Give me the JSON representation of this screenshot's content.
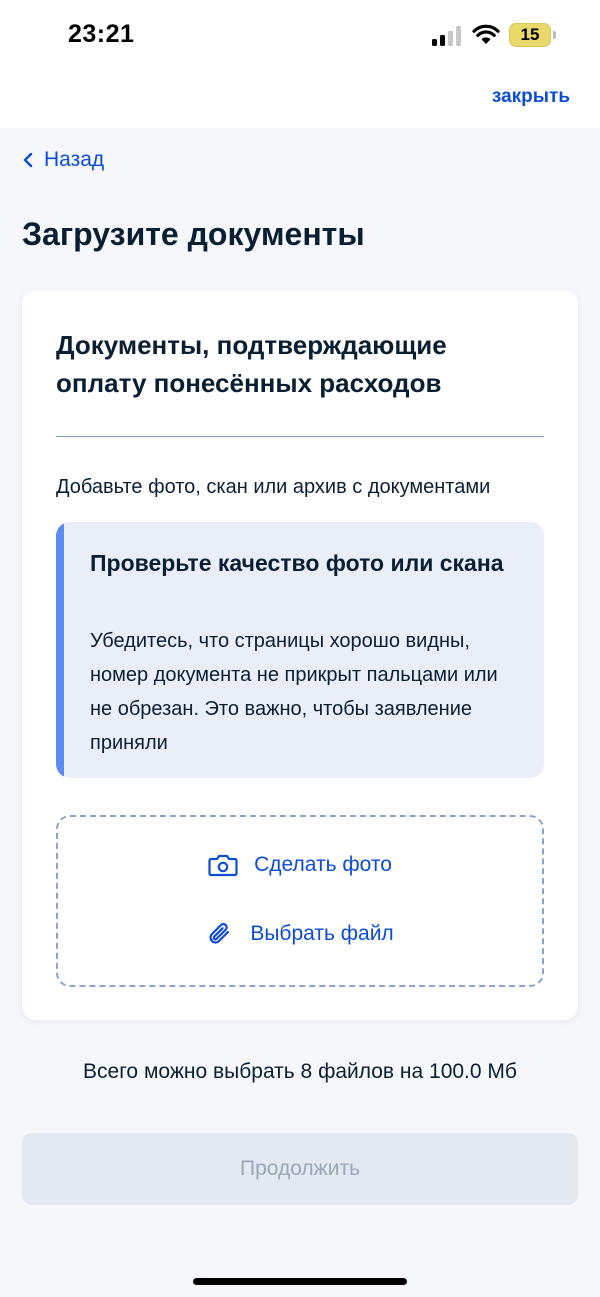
{
  "status_bar": {
    "time": "23:21",
    "battery": "15"
  },
  "header": {
    "close_label": "закрыть",
    "back_label": "Назад"
  },
  "page": {
    "title": "Загрузите документы"
  },
  "card": {
    "title": "Документы, подтверждающие оплату понесённых расходов",
    "description": "Добавьте фото, скан или архив с документами",
    "notice": {
      "title": "Проверьте качество фото или скана",
      "text": "Убедитесь, что страницы хорошо видны, номер документа не прикрыт пальцами или не обрезан. Это важно, чтобы заявление приняли"
    },
    "upload": {
      "take_photo_label": "Сделать фото",
      "choose_file_label": "Выбрать файл"
    }
  },
  "limit_text": "Всего можно выбрать 8 файлов на 100.0 Мб",
  "continue_label": "Продолжить",
  "colors": {
    "accent": "#0d4cd3",
    "notice_bar": "#5b8bf3",
    "notice_bg": "#e9eef9",
    "disabled_bg": "#e4e8f0",
    "disabled_text": "#9aa6b8"
  }
}
